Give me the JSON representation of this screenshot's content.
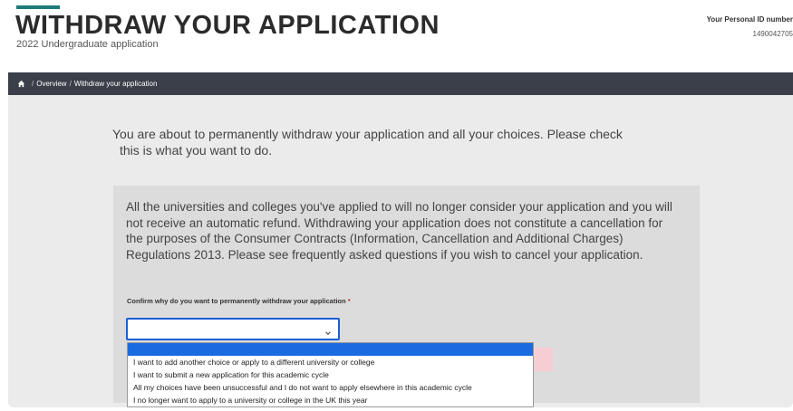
{
  "header": {
    "title": "WITHDRAW YOUR APPLICATION",
    "subtitle": "2022 Undergraduate application",
    "personal_id_label": "Your Personal ID number",
    "personal_id_value": "1490042705"
  },
  "breadcrumb": {
    "home_icon": "home-icon",
    "items": [
      {
        "label": "Overview"
      },
      {
        "label": "Withdraw your application"
      }
    ]
  },
  "main": {
    "intro_line1": "You are about to permanently withdraw your application and all your choices. Please check",
    "intro_line2": "this is what you want to do.",
    "warning": "All the universities and colleges you've applied to will no longer consider your application and you will not receive an automatic refund. Withdrawing your application does not constitute a cancellation for the purposes of the Consumer Contracts (Information, Cancellation and Additional Charges) Regulations 2013. Please see frequently asked questions if you wish to cancel your application.",
    "confirm_label": "Confirm why do you want to permanently withdraw your application",
    "required_marker": "*",
    "select": {
      "value": "",
      "options": [
        {
          "label": ""
        },
        {
          "label": "I want to add another choice or apply to a different university or college"
        },
        {
          "label": "I want to submit a new application for this academic cycle"
        },
        {
          "label": "All my choices have been unsuccessful and I do not want to apply elsewhere in this academic cycle"
        },
        {
          "label": "I no longer want to apply to a university or college in the UK this year"
        }
      ]
    }
  },
  "colors": {
    "accent": "#1f7a7a",
    "nav_bg": "#3a3f49",
    "select_border": "#1a5fd6",
    "highlight": "#1a6be0"
  }
}
